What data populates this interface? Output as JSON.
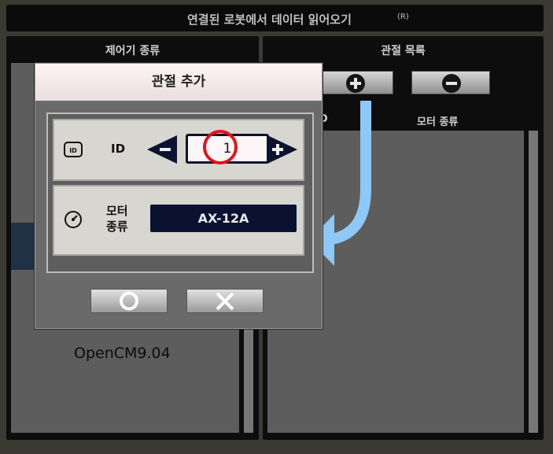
{
  "window": {
    "title": "연결된 로봇에서 데이터 읽어오기",
    "title_suffix": "(R)"
  },
  "left_panel": {
    "header": "제어기 종류",
    "controller_name": "OpenCM9.04"
  },
  "right_panel": {
    "header": "관절 목록",
    "col_id": "ID",
    "col_motor": "모터 종류",
    "add_icon": "plus-circle-icon",
    "remove_icon": "minus-circle-icon"
  },
  "dialog": {
    "title": "관절 추가",
    "id_label": "ID",
    "id_value": "1",
    "motor_label_line1": "모터",
    "motor_label_line2": "종류",
    "motor_value": "AX-12A",
    "ok_icon": "circle-o-icon",
    "cancel_icon": "x-icon"
  },
  "annotations": {
    "highlight_color": "#e0141c",
    "arrow_color": "#8ec8f6"
  }
}
